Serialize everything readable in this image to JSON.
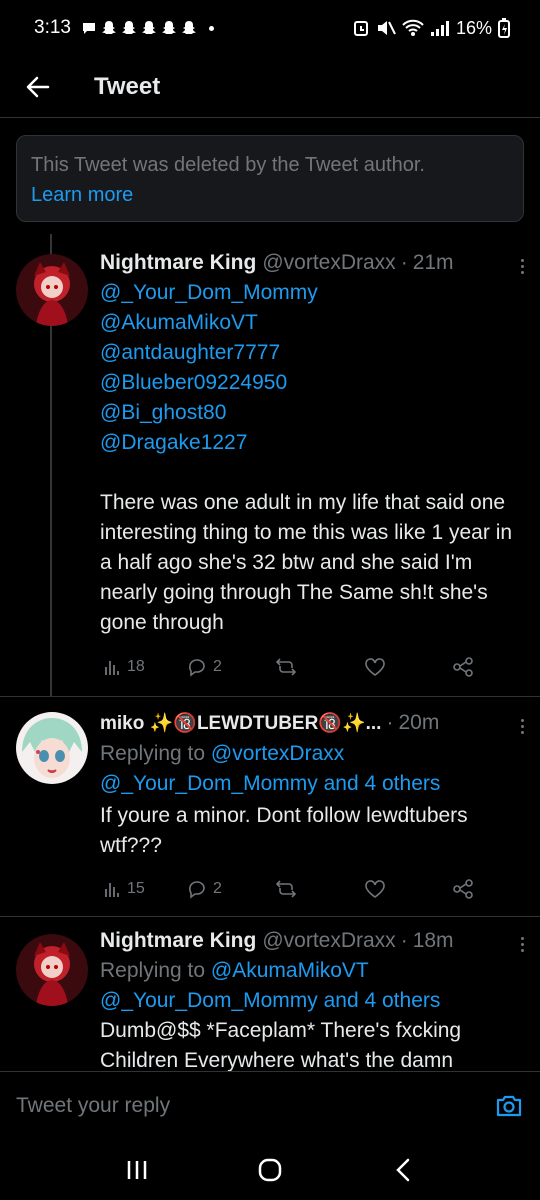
{
  "status_bar": {
    "time": "3:13",
    "battery": "16%",
    "notification_icons": [
      "message-icon",
      "snapchat-icon",
      "snapchat-icon",
      "snapchat-icon",
      "snapchat-icon",
      "snapchat-icon"
    ]
  },
  "header": {
    "title": "Tweet"
  },
  "deleted_notice": {
    "text": "This Tweet was deleted by the Tweet author.",
    "link": "Learn more"
  },
  "tweets": [
    {
      "name": "Nightmare King",
      "handle": "@vortexDraxx",
      "sep": "·",
      "time": "21m",
      "mentions": [
        "@_Your_Dom_Mommy",
        "@AkumaMikoVT",
        "@antdaughter7777",
        "@Blueber09224950",
        "@Bi_ghost80",
        "@Dragake1227"
      ],
      "text": "There was one adult in my life that said one interesting thing to me this was like 1 year in a half ago she's 32 btw and she said I'm nearly going through The Same sh!t she's gone through",
      "views": "18",
      "replies": "2"
    },
    {
      "name": "miko ✨🔞LEWDTUBER🔞✨...",
      "sep": "·",
      "time": "20m",
      "replying_prefix": "Replying to ",
      "replying_to": "@vortexDraxx",
      "replying_others": "@_Your_Dom_Mommy and 4 others",
      "text": "If youre a minor. Dont follow lewdtubers wtf???",
      "views": "15",
      "replies": "2"
    },
    {
      "name": "Nightmare King",
      "handle": "@vortexDraxx",
      "sep": "·",
      "time": "18m",
      "replying_prefix": "Replying to ",
      "replying_to": "@AkumaMikoVT",
      "replying_others": "@_Your_Dom_Mommy and 4 others",
      "text": "Dumb@$$ *Faceplam* There's fxcking Children Everywhere what's the damn"
    }
  ],
  "reply_bar": {
    "placeholder": "Tweet your reply"
  },
  "colors": {
    "accent": "#1d9bf0",
    "muted": "#71767b",
    "text": "#e7e9ea",
    "background": "#000000"
  }
}
